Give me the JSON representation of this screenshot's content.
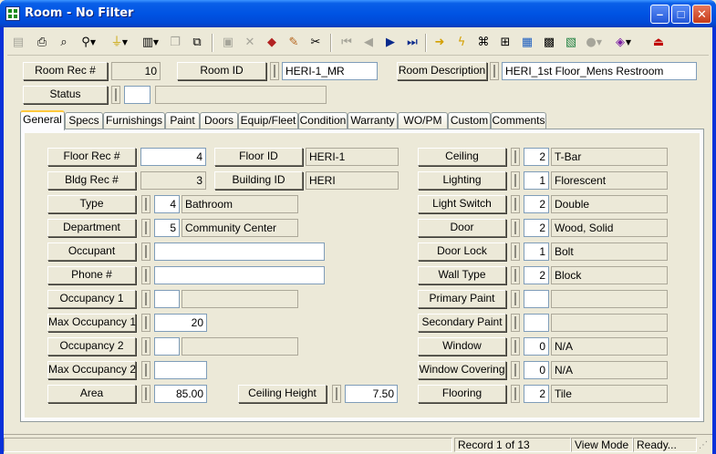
{
  "window": {
    "title": "Room - No Filter"
  },
  "toolbar": {
    "icons": [
      "new-record",
      "print",
      "print-preview",
      "find",
      "filter",
      "report",
      "copy",
      "duplicate",
      "save",
      "delete",
      "spellcheck",
      "edit",
      "cut",
      "first-record",
      "previous-record",
      "next-record",
      "last-record",
      "goto",
      "execute",
      "hierarchy",
      "tree",
      "map",
      "calculator",
      "image",
      "globe",
      "bookmark",
      "exit"
    ]
  },
  "header": {
    "room_rec_label": "Room Rec #",
    "room_rec_value": "10",
    "room_id_label": "Room ID",
    "room_id_value": "HERI-1_MR",
    "room_desc_label": "Room Description",
    "room_desc_value": "HERI_1st Floor_Mens Restroom",
    "status_label": "Status",
    "status_code": "",
    "status_desc": ""
  },
  "tabs": [
    "General",
    "Specs",
    "Furnishings",
    "Paint",
    "Doors",
    "Equip/Fleet",
    "Condition",
    "Warranty",
    "WO/PM",
    "Custom",
    "Comments"
  ],
  "active_tab": "General",
  "general": {
    "floor_rec": {
      "label": "Floor Rec #",
      "value": "4"
    },
    "floor_id": {
      "label": "Floor ID",
      "value": "HERI-1"
    },
    "bldg_rec": {
      "label": "Bldg Rec #",
      "value": "3"
    },
    "building_id": {
      "label": "Building ID",
      "value": "HERI"
    },
    "type": {
      "label": "Type",
      "code": "4",
      "desc": "Bathroom"
    },
    "department": {
      "label": "Department",
      "code": "5",
      "desc": "Community Center"
    },
    "occupant": {
      "label": "Occupant",
      "value": ""
    },
    "phone": {
      "label": "Phone #",
      "value": ""
    },
    "occupancy1": {
      "label": "Occupancy 1",
      "code": "",
      "desc": ""
    },
    "max_occupancy1": {
      "label": "Max Occupancy 1",
      "value": "20"
    },
    "occupancy2": {
      "label": "Occupancy 2",
      "code": "",
      "desc": ""
    },
    "max_occupancy2": {
      "label": "Max Occupancy 2",
      "value": ""
    },
    "area": {
      "label": "Area",
      "value": "85.00"
    },
    "ceiling_height": {
      "label": "Ceiling Height",
      "value": "7.50"
    },
    "ceiling": {
      "label": "Ceiling",
      "code": "2",
      "desc": "T-Bar"
    },
    "lighting": {
      "label": "Lighting",
      "code": "1",
      "desc": "Florescent"
    },
    "light_switch": {
      "label": "Light Switch",
      "code": "2",
      "desc": "Double"
    },
    "door": {
      "label": "Door",
      "code": "2",
      "desc": "Wood, Solid"
    },
    "door_lock": {
      "label": "Door Lock",
      "code": "1",
      "desc": "Bolt"
    },
    "wall_type": {
      "label": "Wall Type",
      "code": "2",
      "desc": "Block"
    },
    "primary_paint": {
      "label": "Primary Paint",
      "code": "",
      "desc": ""
    },
    "secondary_paint": {
      "label": "Secondary Paint",
      "code": "",
      "desc": ""
    },
    "window": {
      "label": "Window",
      "code": "0",
      "desc": "N/A"
    },
    "window_covering": {
      "label": "Window Covering",
      "code": "0",
      "desc": "N/A"
    },
    "flooring": {
      "label": "Flooring",
      "code": "2",
      "desc": "Tile"
    }
  },
  "status_bar": {
    "record": "Record 1 of 13",
    "mode": "View Mode",
    "state": "Ready..."
  }
}
